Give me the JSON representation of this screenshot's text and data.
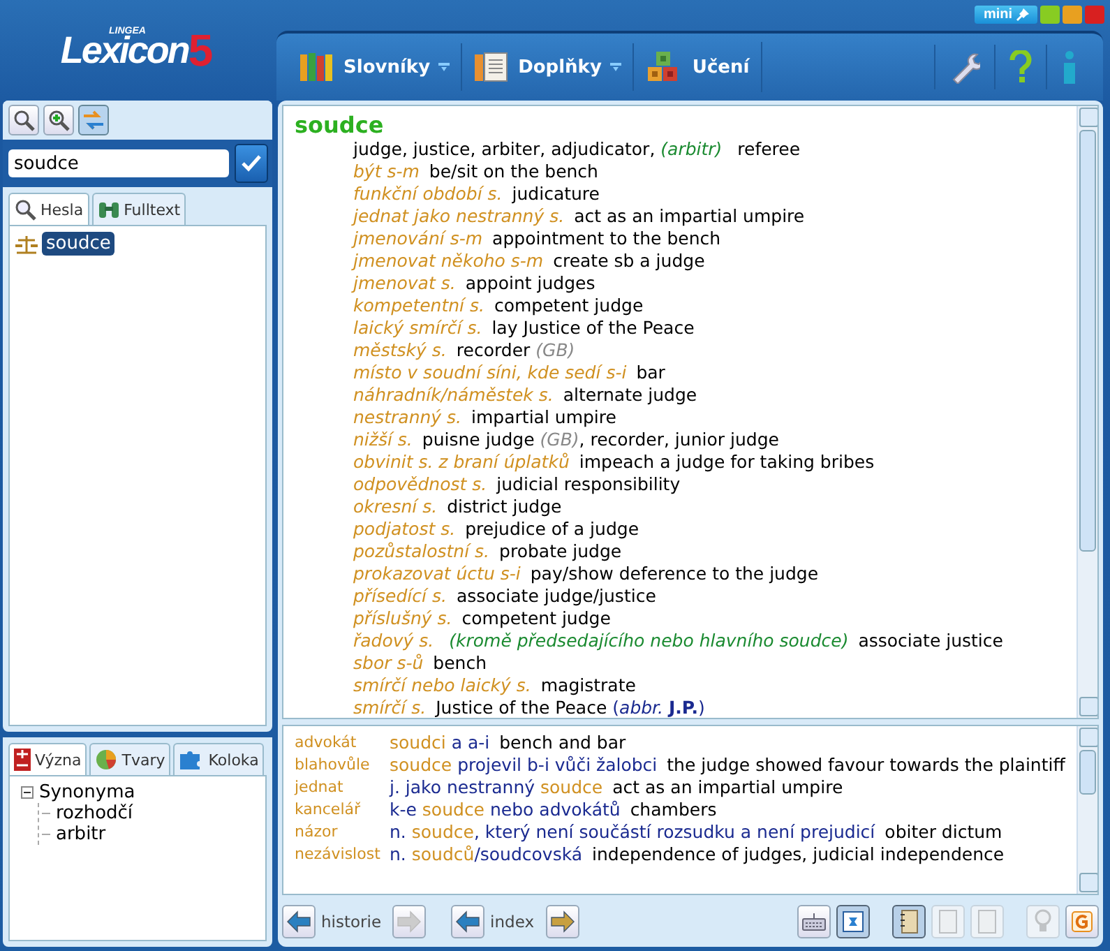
{
  "window": {
    "mini_label": "mini"
  },
  "logo": {
    "brand": "LINGEA",
    "name": "Lexicon",
    "number": "5"
  },
  "menu": [
    {
      "label": "Slovníky",
      "kind": "books",
      "dropdown": true
    },
    {
      "label": "Doplňky",
      "kind": "pages",
      "dropdown": true
    },
    {
      "label": "Učení",
      "kind": "blocks",
      "dropdown": false
    }
  ],
  "search": {
    "value": "soudce"
  },
  "search_tools": [
    {
      "kind": "search",
      "selected": false
    },
    {
      "kind": "zoom-plus",
      "selected": false
    },
    {
      "kind": "swap",
      "selected": true
    }
  ],
  "tabs": [
    {
      "label": "Hesla",
      "kind": "search",
      "selected": true
    },
    {
      "label": "Fulltext",
      "kind": "binoculars",
      "selected": false
    }
  ],
  "word_list": [
    {
      "label": "soudce",
      "selected": true
    }
  ],
  "bottom_tabs": [
    {
      "label": "Význa",
      "kind": "plusminus",
      "selected": true
    },
    {
      "label": "Tvary",
      "kind": "pie",
      "selected": false
    },
    {
      "label": "Koloka",
      "kind": "puzzle",
      "selected": false
    }
  ],
  "tree": [
    {
      "label": "Synonyma",
      "expanded": true,
      "children": [
        {
          "label": "rozhodčí"
        },
        {
          "label": "arbitr"
        }
      ]
    }
  ],
  "entry": {
    "headword": "soudce",
    "lines": [
      [
        {
          "kind": "en",
          "text": "judge, justice, arbiter, adjudicator, "
        },
        {
          "kind": "note",
          "text": "(arbitr)"
        },
        {
          "kind": "en",
          "text": " referee"
        }
      ],
      [
        {
          "kind": "cz",
          "text": "být s-m"
        },
        {
          "kind": "en",
          "text": "be/sit on the bench"
        }
      ],
      [
        {
          "kind": "cz",
          "text": "funkční období s."
        },
        {
          "kind": "en",
          "text": "judicature"
        }
      ],
      [
        {
          "kind": "cz",
          "text": "jednat jako nestranný s."
        },
        {
          "kind": "en",
          "text": "act as an impartial umpire"
        }
      ],
      [
        {
          "kind": "cz",
          "text": "jmenování s-m"
        },
        {
          "kind": "en",
          "text": "appointment to the bench"
        }
      ],
      [
        {
          "kind": "cz",
          "text": "jmenovat někoho s-m"
        },
        {
          "kind": "en",
          "text": "create sb a judge"
        }
      ],
      [
        {
          "kind": "cz",
          "text": "jmenovat s."
        },
        {
          "kind": "en",
          "text": "appoint judges"
        }
      ],
      [
        {
          "kind": "cz",
          "text": "kompetentní s."
        },
        {
          "kind": "en",
          "text": "competent judge"
        }
      ],
      [
        {
          "kind": "cz",
          "text": "laický smírčí s."
        },
        {
          "kind": "en",
          "text": "lay Justice of the Peace"
        }
      ],
      [
        {
          "kind": "cz",
          "text": "městský s."
        },
        {
          "kind": "en",
          "text": "recorder "
        },
        {
          "kind": "gb",
          "text": "(GB)"
        }
      ],
      [
        {
          "kind": "cz",
          "text": "místo v soudní síni, kde sedí s-i"
        },
        {
          "kind": "en",
          "text": "bar"
        }
      ],
      [
        {
          "kind": "cz",
          "text": "náhradník/náměstek s."
        },
        {
          "kind": "en",
          "text": "alternate judge"
        }
      ],
      [
        {
          "kind": "cz",
          "text": "nestranný s."
        },
        {
          "kind": "en",
          "text": "impartial umpire"
        }
      ],
      [
        {
          "kind": "cz",
          "text": "nižší s."
        },
        {
          "kind": "en",
          "text": "puisne judge "
        },
        {
          "kind": "gb",
          "text": "(GB)"
        },
        {
          "kind": "en",
          "text": ", recorder, junior judge"
        }
      ],
      [
        {
          "kind": "cz",
          "text": "obvinit s. z braní úplatků"
        },
        {
          "kind": "en",
          "text": "impeach a judge for taking bribes"
        }
      ],
      [
        {
          "kind": "cz",
          "text": "odpovědnost s."
        },
        {
          "kind": "en",
          "text": "judicial responsibility"
        }
      ],
      [
        {
          "kind": "cz",
          "text": "okresní s."
        },
        {
          "kind": "en",
          "text": "district judge"
        }
      ],
      [
        {
          "kind": "cz",
          "text": "podjatost s."
        },
        {
          "kind": "en",
          "text": "prejudice of a judge"
        }
      ],
      [
        {
          "kind": "cz",
          "text": "pozůstalostní s."
        },
        {
          "kind": "en",
          "text": "probate judge"
        }
      ],
      [
        {
          "kind": "cz",
          "text": "prokazovat úctu s-i"
        },
        {
          "kind": "en",
          "text": "pay/show deference to the judge"
        }
      ],
      [
        {
          "kind": "cz",
          "text": "přísedící s."
        },
        {
          "kind": "en",
          "text": "associate judge/justice"
        }
      ],
      [
        {
          "kind": "cz",
          "text": "příslušný s."
        },
        {
          "kind": "en",
          "text": "competent judge"
        }
      ],
      [
        {
          "kind": "cz",
          "text": "řadový s. "
        },
        {
          "kind": "note",
          "text": "(kromě předsedajícího nebo hlavního soudce)"
        },
        {
          "kind": "en",
          "text": "associate justice"
        }
      ],
      [
        {
          "kind": "cz",
          "text": "sbor s-ů"
        },
        {
          "kind": "en",
          "text": "bench"
        }
      ],
      [
        {
          "kind": "cz",
          "text": "smírčí nebo laický s."
        },
        {
          "kind": "en",
          "text": "magistrate"
        }
      ],
      [
        {
          "kind": "cz",
          "text": "smírčí s."
        },
        {
          "kind": "en",
          "text": "Justice of the Peace "
        },
        {
          "kind": "abbr",
          "text": "(*abbr.* **J.P.**)"
        }
      ]
    ]
  },
  "examples": [
    {
      "headword": "advokát",
      "parts": [
        {
          "kind": "hl",
          "text": "soudci"
        },
        {
          "kind": "cz",
          "text": " a a-i"
        },
        {
          "kind": "en",
          "text": "bench and bar"
        }
      ]
    },
    {
      "headword": "blahovůle",
      "parts": [
        {
          "kind": "hl",
          "text": "soudce"
        },
        {
          "kind": "cz",
          "text": " projevil b-i vůči žalobci"
        },
        {
          "kind": "en",
          "text": "the judge showed favour towards the plaintiff"
        }
      ]
    },
    {
      "headword": "jednat",
      "parts": [
        {
          "kind": "cz",
          "text": "j. jako nestranný "
        },
        {
          "kind": "hl",
          "text": "soudce"
        },
        {
          "kind": "en",
          "text": "act as an impartial umpire"
        }
      ]
    },
    {
      "headword": "kancelář",
      "parts": [
        {
          "kind": "cz",
          "text": "k-e "
        },
        {
          "kind": "hl",
          "text": "soudce"
        },
        {
          "kind": "cz",
          "text": " nebo advokátů"
        },
        {
          "kind": "en",
          "text": "chambers"
        }
      ]
    },
    {
      "headword": "názor",
      "parts": [
        {
          "kind": "cz",
          "text": "n. "
        },
        {
          "kind": "hl",
          "text": "soudce"
        },
        {
          "kind": "cz",
          "text": ", který není součástí rozsudku a není prejudicí"
        },
        {
          "kind": "en",
          "text": "obiter dictum"
        }
      ]
    },
    {
      "headword": "nezávislost",
      "parts": [
        {
          "kind": "cz",
          "text": "n. "
        },
        {
          "kind": "hl",
          "text": "soudců"
        },
        {
          "kind": "cz",
          "text": "/soudcovská"
        },
        {
          "kind": "en",
          "text": "independence of judges, judicial independence"
        }
      ]
    }
  ],
  "nav": {
    "history_label": "historie",
    "index_label": "index",
    "history_back_disabled": false,
    "history_forward_disabled": true,
    "index_back_disabled": false,
    "index_forward_disabled": false
  },
  "tools": [
    {
      "kind": "keyboard",
      "selected": false,
      "disabled": false
    },
    {
      "kind": "card",
      "selected": true,
      "disabled": false
    },
    {
      "kind": "notebook",
      "selected": true,
      "disabled": false
    },
    {
      "kind": "page",
      "selected": false,
      "disabled": true
    },
    {
      "kind": "page",
      "selected": false,
      "disabled": true
    },
    {
      "kind": "bulb",
      "selected": false,
      "disabled": true
    },
    {
      "kind": "letter",
      "selected": false,
      "disabled": false
    }
  ]
}
